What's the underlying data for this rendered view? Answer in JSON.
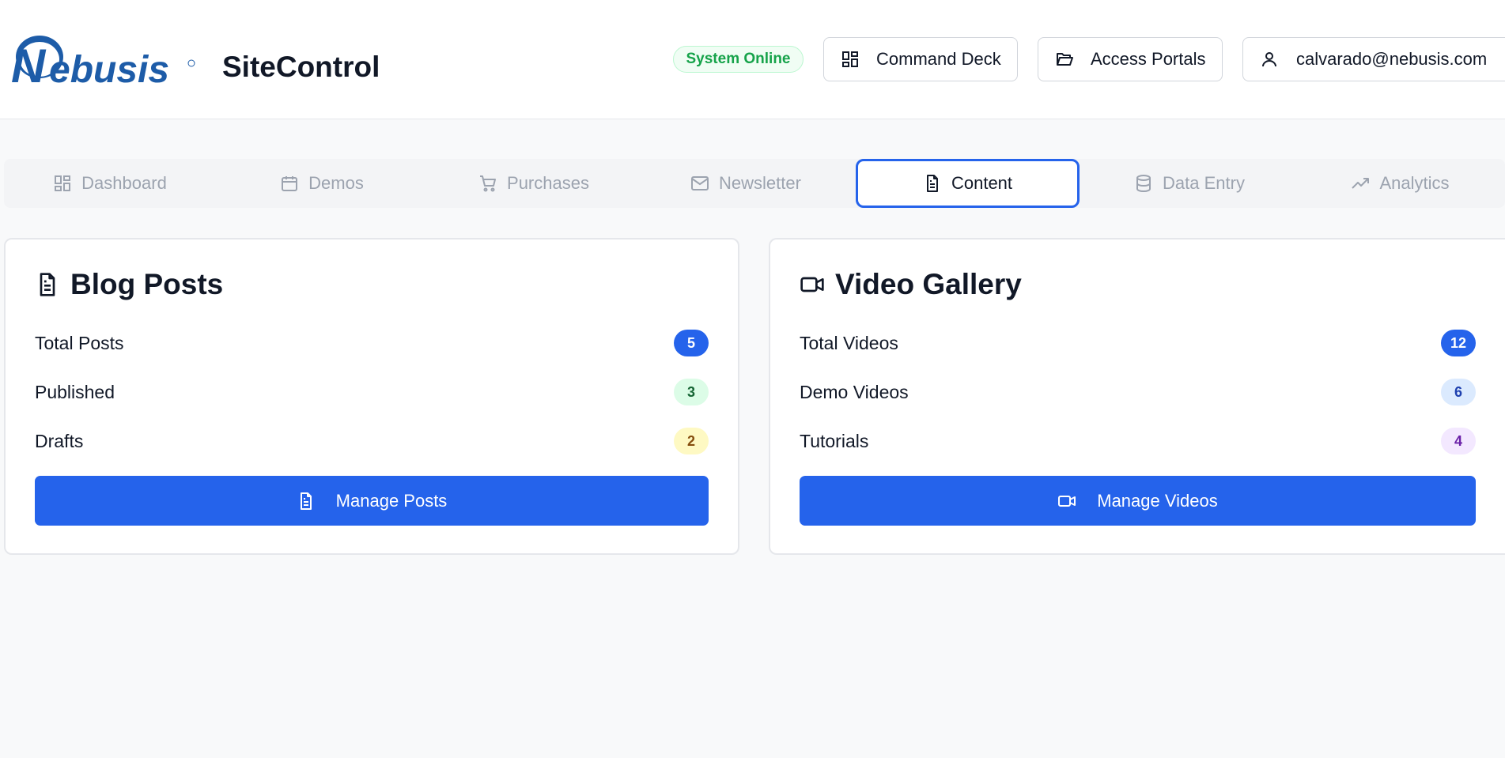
{
  "header": {
    "logo_text": "Nebusis",
    "app_title": "SiteControl",
    "status": "System Online",
    "command_deck_label": "Command Deck",
    "access_portals_label": "Access Portals",
    "user_email": "calvarado@nebusis.com"
  },
  "tabs": [
    {
      "label": "Dashboard",
      "icon": "dashboard-icon",
      "active": false
    },
    {
      "label": "Demos",
      "icon": "calendar-icon",
      "active": false
    },
    {
      "label": "Purchases",
      "icon": "cart-icon",
      "active": false
    },
    {
      "label": "Newsletter",
      "icon": "mail-icon",
      "active": false
    },
    {
      "label": "Content",
      "icon": "document-icon",
      "active": true
    },
    {
      "label": "Data Entry",
      "icon": "database-icon",
      "active": false
    },
    {
      "label": "Analytics",
      "icon": "trending-up-icon",
      "active": false
    }
  ],
  "blog": {
    "title": "Blog Posts",
    "stats": [
      {
        "label": "Total Posts",
        "value": "5"
      },
      {
        "label": "Published",
        "value": "3"
      },
      {
        "label": "Drafts",
        "value": "2"
      }
    ],
    "action_label": "Manage Posts"
  },
  "video": {
    "title": "Video Gallery",
    "stats": [
      {
        "label": "Total Videos",
        "value": "12"
      },
      {
        "label": "Demo Videos",
        "value": "6"
      },
      {
        "label": "Tutorials",
        "value": "4"
      }
    ],
    "action_label": "Manage Videos"
  },
  "colors": {
    "accent": "#2563eb",
    "status_green": "#16a34a",
    "logo_blue": "#1d5ca8"
  }
}
